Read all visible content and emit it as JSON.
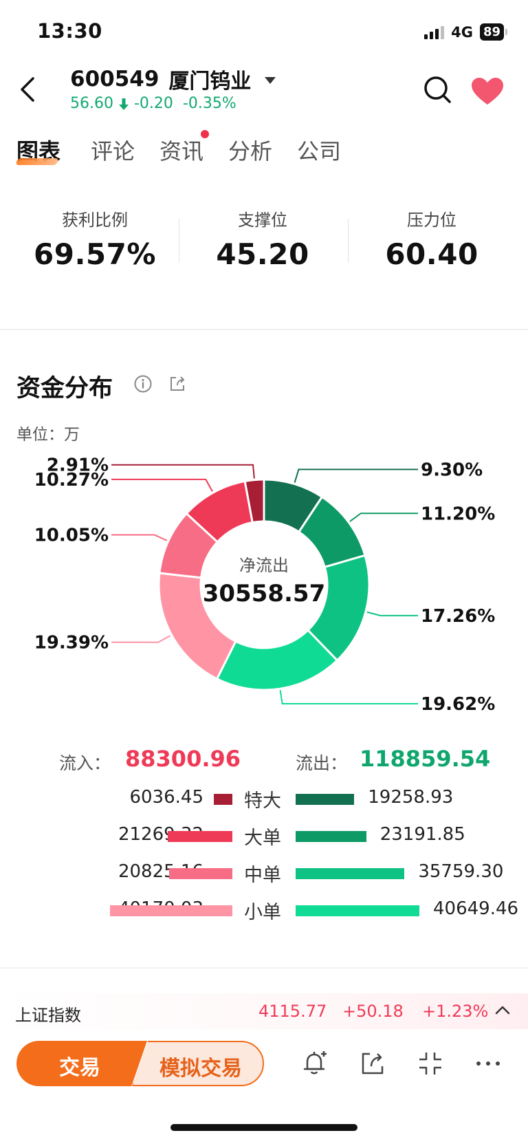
{
  "status_bar": {
    "time": "13:30",
    "network": "4G",
    "battery": "89"
  },
  "header": {
    "stock_code": "600549",
    "stock_name": "厦门钨业",
    "price": "56.60",
    "change": "-0.20",
    "change_pct": "-0.35%"
  },
  "tabs": [
    {
      "label": "图表",
      "active": true
    },
    {
      "label": "评论"
    },
    {
      "label": "资讯",
      "has_dot": true
    },
    {
      "label": "分析"
    },
    {
      "label": "公司"
    }
  ],
  "stats": [
    {
      "label": "获利比例",
      "value": "69.57%"
    },
    {
      "label": "支撑位",
      "value": "45.20"
    },
    {
      "label": "压力位",
      "value": "60.40"
    }
  ],
  "capital": {
    "title": "资金分布",
    "unit": "单位：万",
    "center_label": "净流出",
    "center_value": "30558.57"
  },
  "chart_data": {
    "type": "pie",
    "slices": [
      {
        "label": "9.30%",
        "value": 9.3,
        "color": "#137152"
      },
      {
        "label": "11.20%",
        "value": 11.2,
        "color": "#0d9a66"
      },
      {
        "label": "17.26%",
        "value": 17.26,
        "color": "#0ec283"
      },
      {
        "label": "19.62%",
        "value": 19.62,
        "color": "#0fdb94"
      },
      {
        "label": "19.39%",
        "value": 19.39,
        "color": "#ff94a5"
      },
      {
        "label": "10.05%",
        "value": 10.05,
        "color": "#f76d85"
      },
      {
        "label": "10.27%",
        "value": 10.27,
        "color": "#ef3a57"
      },
      {
        "label": "2.91%",
        "value": 2.91,
        "color": "#a71e35"
      }
    ]
  },
  "flow": {
    "in_label": "流入：",
    "in_value": "88300.96",
    "out_label": "流出：",
    "out_value": "118859.54",
    "rows": [
      {
        "category": "特大",
        "inflow": "6036.45",
        "inflow_num": 6036.45,
        "outflow": "19258.93",
        "outflow_num": 19258.93,
        "in_color": "#a71e35",
        "out_color": "#137152"
      },
      {
        "category": "大单",
        "inflow": "21269.32",
        "inflow_num": 21269.32,
        "outflow": "23191.85",
        "outflow_num": 23191.85,
        "in_color": "#ef3a57",
        "out_color": "#0d9a66"
      },
      {
        "category": "中单",
        "inflow": "20825.16",
        "inflow_num": 20825.16,
        "outflow": "35759.30",
        "outflow_num": 35759.3,
        "in_color": "#f76d85",
        "out_color": "#0ec283"
      },
      {
        "category": "小单",
        "inflow": "40170.03",
        "inflow_num": 40170.03,
        "outflow": "40649.46",
        "outflow_num": 40649.46,
        "in_color": "#ff94a5",
        "out_color": "#0fdb94"
      }
    ]
  },
  "ticker": {
    "name": "上证指数",
    "price": "4115.77",
    "change": "+50.18",
    "change_pct": "+1.23%"
  },
  "bottom_bar": {
    "trade_label": "交易",
    "sim_trade_label": "模拟交易"
  },
  "icons": [
    "back-icon",
    "dropdown-icon",
    "search-icon",
    "heart-icon",
    "info-icon",
    "share-icon",
    "alert-add-icon",
    "share-out-icon",
    "collapse-icon",
    "more-icon",
    "chevron-up-icon"
  ]
}
